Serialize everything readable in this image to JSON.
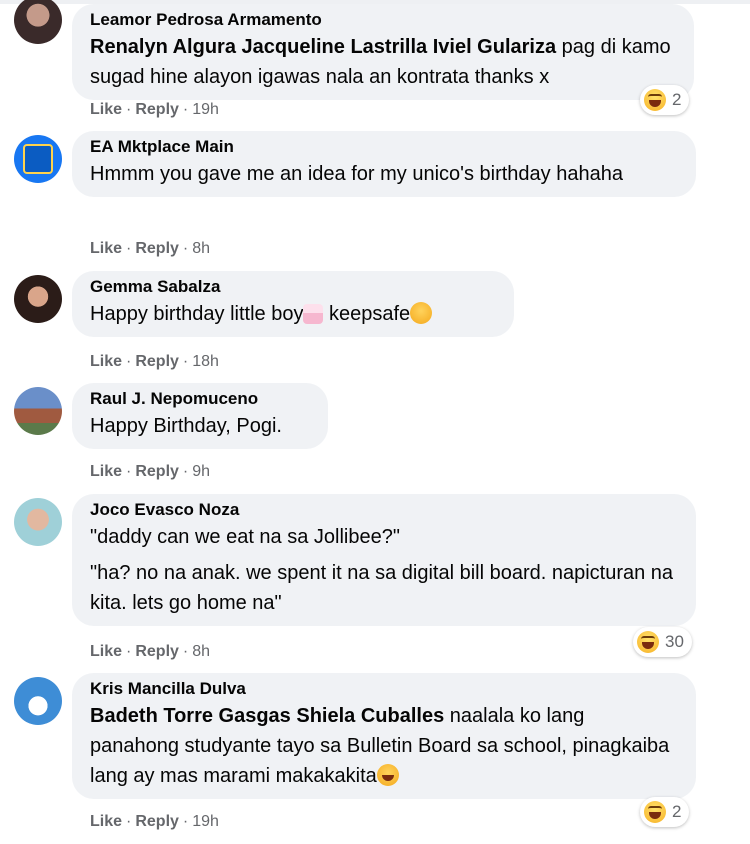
{
  "comments": [
    {
      "author": "Leamor Pedrosa Armamento",
      "mention": "Renalyn Algura Jacqueline Lastrilla Iviel Gulariza",
      "text": " pag di kamo sugad hine alayon igawas nala an kontrata thanks x",
      "like": "Like",
      "reply": "Reply",
      "sep": "·",
      "time": "19h",
      "reaction_count": "2",
      "reaction_icon": "haha-icon"
    },
    {
      "author": "EA Mktplace Main",
      "text": "Hmmm you gave me an idea for my unico's birthday hahaha",
      "like": "Like",
      "reply": "Reply",
      "sep": "·",
      "time": "8h"
    },
    {
      "author": "Gemma Sabalza",
      "text_a": "Happy birthday little boy",
      "text_b": " keepsafe",
      "like": "Like",
      "reply": "Reply",
      "sep": "·",
      "time": "18h",
      "emojis": [
        "birthday-cake-icon",
        "smiling-face-icon"
      ]
    },
    {
      "author": "Raul J. Nepomuceno",
      "text": "Happy Birthday, Pogi.",
      "like": "Like",
      "reply": "Reply",
      "sep": "·",
      "time": "9h"
    },
    {
      "author": "Joco Evasco Noza",
      "text_1": "\"daddy can we eat na sa Jollibee?\"",
      "text_2": "\"ha? no na anak. we spent it na sa digital bill board. napicturan na kita. lets go home na\"",
      "like": "Like",
      "reply": "Reply",
      "sep": "·",
      "time": "8h",
      "reaction_count": "30",
      "reaction_icon": "haha-icon"
    },
    {
      "author": "Kris Mancilla Dulva",
      "mention": "Badeth Torre Gasgas Shiela Cuballes",
      "text": " naalala ko lang panahong studyante tayo sa Bulletin Board sa school, pinagkaiba lang ay mas marami makakakita",
      "like": "Like",
      "reply": "Reply",
      "sep": "·",
      "time": "19h",
      "reaction_count": "2",
      "reaction_icon": "haha-icon",
      "emojis": [
        "laughing-face-icon"
      ]
    }
  ]
}
